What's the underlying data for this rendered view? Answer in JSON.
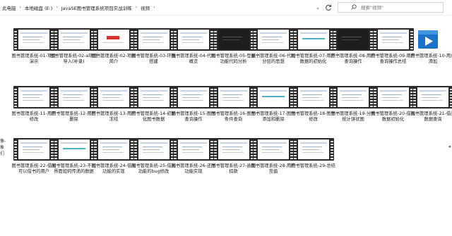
{
  "address": {
    "crumbs": [
      "此电脑",
      "本地磁盘 (E:)",
      "JavaSE图书管理系统项目实战训练",
      "视频"
    ],
    "refresh_icon": "refresh-icon",
    "dropdown_icon": "chevron-down-icon"
  },
  "search": {
    "placeholder": "搜索\"视频\"",
    "icon": "search-icon"
  },
  "left_edge_text": [
    "像-",
    "象们"
  ],
  "files": [
    {
      "label": "图书管理系统-01-项目演示",
      "thumb": "light"
    },
    {
      "label": "图书管理系统-02-a项目导入(补录)",
      "thumb": "light"
    },
    {
      "label": "图书管理系统-02-项目简介",
      "thumb": "accent"
    },
    {
      "label": "图书管理系统-03-环境搭建",
      "thumb": "light"
    },
    {
      "label": "图书管理系统-04-代码概览",
      "thumb": "light"
    },
    {
      "label": "图书管理系统-05-登录功能代码分析",
      "thumb": "dark"
    },
    {
      "label": "图书管理系统-06-代码分层的思想",
      "thumb": "light"
    },
    {
      "label": "图书管理系统-07-用户数据的初始化",
      "thumb": "teal"
    },
    {
      "label": "图书管理系统-08-用户查询操作",
      "thumb": "dark"
    },
    {
      "label": "图书管理系统-09-用户查询操作总结",
      "thumb": "light"
    },
    {
      "label": "图书管理系统-10-用户添加",
      "thumb": "player"
    },
    {
      "label": "图书管理系统-11-用户修改",
      "thumb": "light"
    },
    {
      "label": "图书管理系统-12-用户删除",
      "thumb": "light"
    },
    {
      "label": "图书管理系统-13-用户冻结",
      "thumb": "light"
    },
    {
      "label": "图书管理系统-14-初始化图书数据",
      "thumb": "light"
    },
    {
      "label": "图书管理系统-15-图书查询操作",
      "thumb": "light"
    },
    {
      "label": "图书管理系统-16-图书条件查询",
      "thumb": "light"
    },
    {
      "label": "图书管理系统-17-图书添加和删除",
      "thumb": "teal"
    },
    {
      "label": "图书管理系统-18-图书修改",
      "thumb": "light"
    },
    {
      "label": "图书管理系统-19-分类统计饼状图",
      "thumb": "light"
    },
    {
      "label": "图书管理系统-20-借阅数据初始化",
      "thumb": "light"
    },
    {
      "label": "图书管理系统-21-借阅数据查询",
      "thumb": "light"
    },
    {
      "label": "图书管理系统-22-借阅可以借书的用户",
      "thumb": "light"
    },
    {
      "label": "图书管理系统-23-不同界面如何传递的数据",
      "thumb": "teal"
    },
    {
      "label": "图书管理系统-24-借阅功能的实现",
      "thumb": "light"
    },
    {
      "label": "图书管理系统-25-借阅功能的bug修改",
      "thumb": "light"
    },
    {
      "label": "图书管理系统-26-还书功能实现",
      "thumb": "light"
    },
    {
      "label": "图书管理系统-27-逾期扣款",
      "thumb": "light"
    },
    {
      "label": "图书管理系统-28-用户充值",
      "thumb": "light"
    },
    {
      "label": "图书管理系统-29-总结",
      "thumb": "light"
    }
  ]
}
